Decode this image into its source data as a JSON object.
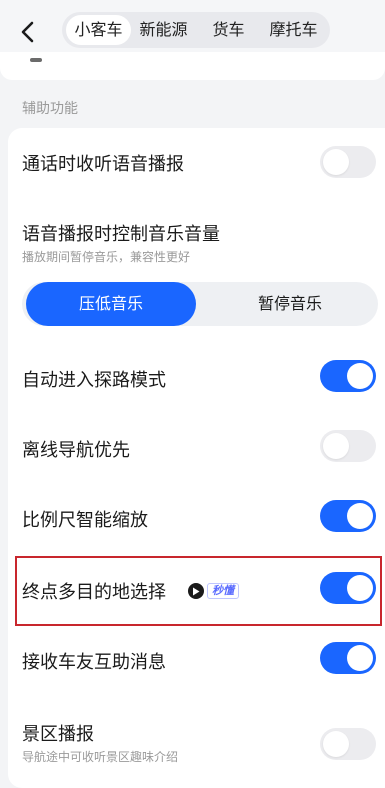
{
  "header": {
    "back_icon": "chevron-left-icon",
    "tabs": [
      {
        "label": "小客车",
        "active": true
      },
      {
        "label": "新能源",
        "active": false
      },
      {
        "label": "货车",
        "active": false
      },
      {
        "label": "摩托车",
        "active": false
      }
    ]
  },
  "section": {
    "title": "辅助功能"
  },
  "settings": {
    "call_voice": {
      "label": "通话时收听语音播报",
      "enabled": false
    },
    "music_control": {
      "label": "语音播报时控制音乐音量",
      "sub": "播放期间暂停音乐，兼容性更好",
      "options": [
        "压低音乐",
        "暂停音乐"
      ],
      "selected": "压低音乐"
    },
    "explore_mode": {
      "label": "自动进入探路模式",
      "enabled": true
    },
    "offline_nav": {
      "label": "离线导航优先",
      "enabled": false
    },
    "smart_zoom": {
      "label": "比例尺智能缩放",
      "enabled": true
    },
    "multi_destination": {
      "label": "终点多目的地选择",
      "badge": "秒懂",
      "enabled": true
    },
    "friend_help": {
      "label": "接收车友互助消息",
      "enabled": true
    },
    "scenic_broadcast": {
      "label": "景区播报",
      "sub": "导航途中可收听景区趣味介绍",
      "enabled": false
    }
  },
  "colors": {
    "accent": "#1a66ff",
    "toggle_off": "#ececef",
    "highlight": "#c8262d",
    "background": "#f3f4f6"
  }
}
